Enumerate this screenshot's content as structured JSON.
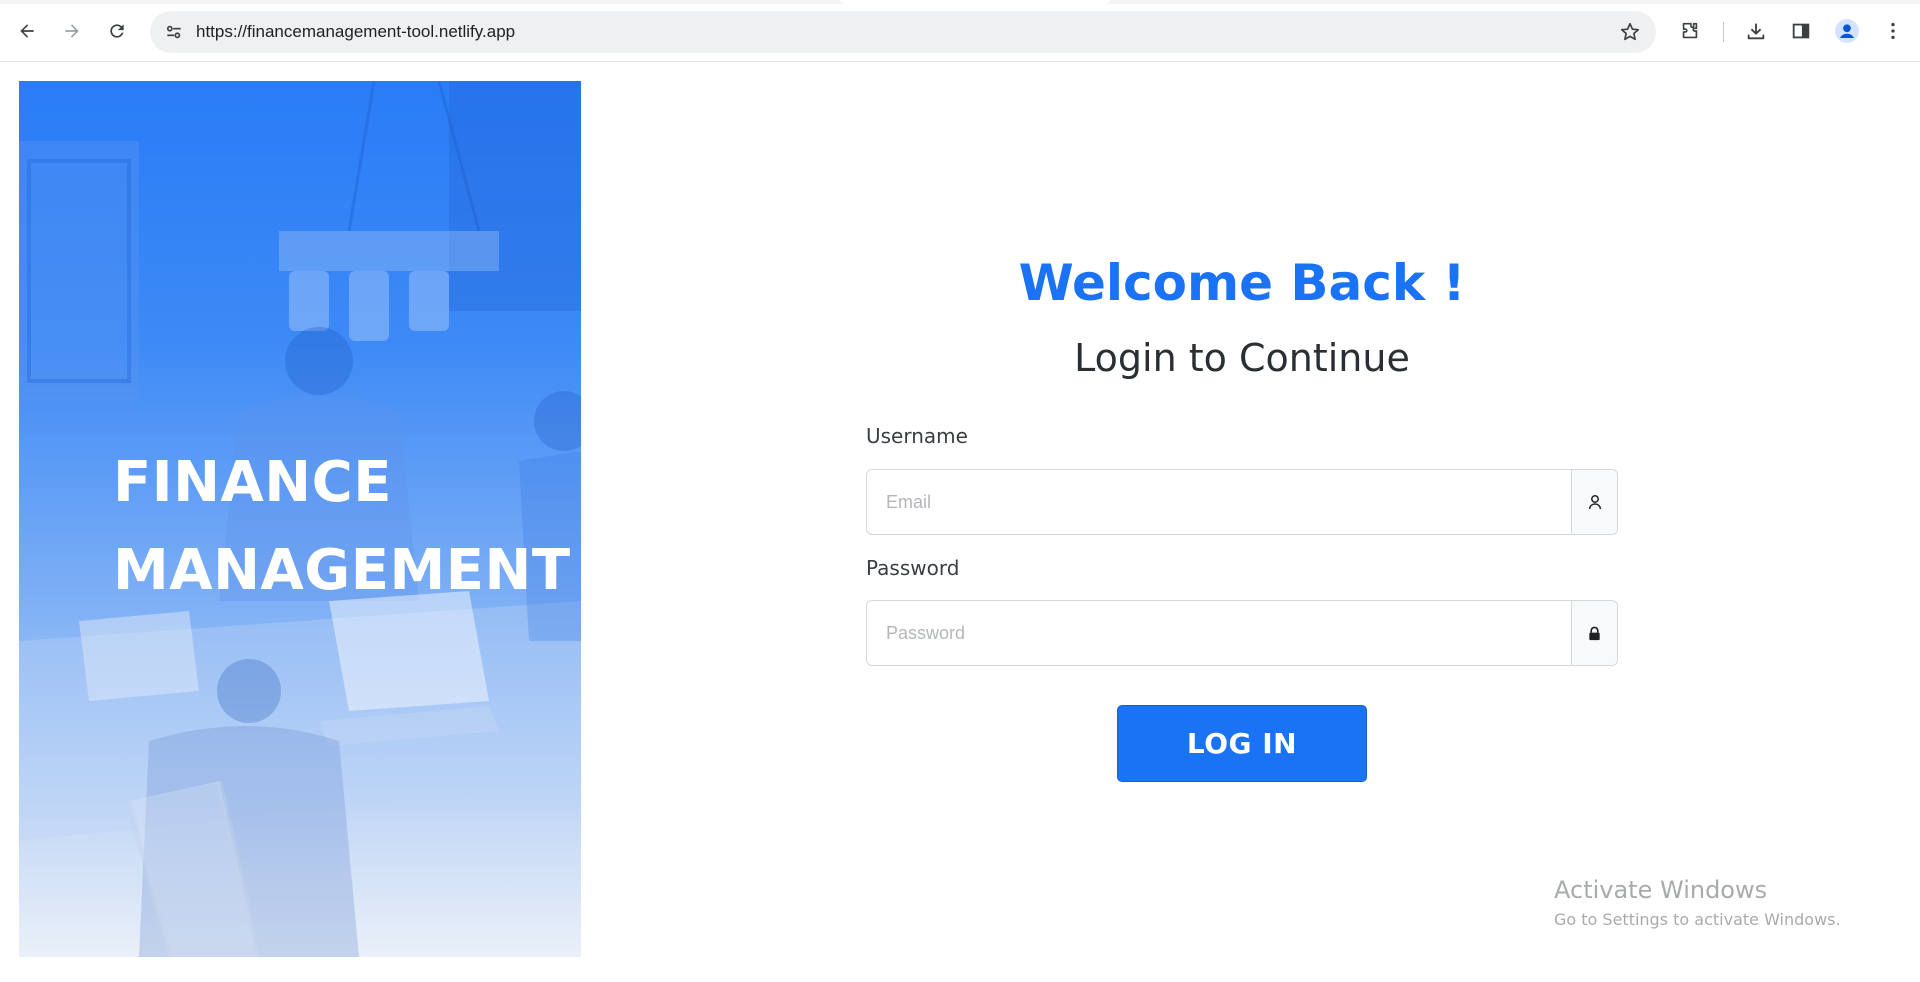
{
  "browser": {
    "url": "https://financemanagement-tool.netlify.app",
    "icons": {
      "back": "arrow-left-icon",
      "forward": "arrow-right-icon",
      "reload": "reload-icon",
      "site_info": "tune-icon",
      "bookmark": "star-icon",
      "extensions": "puzzle-icon",
      "downloads": "download-icon",
      "side_panel": "side-panel-icon",
      "profile": "avatar-icon",
      "menu": "kebab-menu-icon"
    }
  },
  "hero": {
    "title_line1": "FINANCE",
    "title_line2": "MANAGEMENT"
  },
  "login": {
    "heading": "Welcome Back !",
    "subheading": "Login to Continue",
    "username_label": "Username",
    "username_placeholder": "Email",
    "password_label": "Password",
    "password_placeholder": "Password",
    "button_label": "LOG IN"
  },
  "watermark": {
    "title": "Activate Windows",
    "subtitle": "Go to Settings to activate Windows."
  },
  "colors": {
    "accent": "#1a73f5",
    "hero_top": "#2a7cf7",
    "hero_bottom": "#eaf0f8"
  }
}
